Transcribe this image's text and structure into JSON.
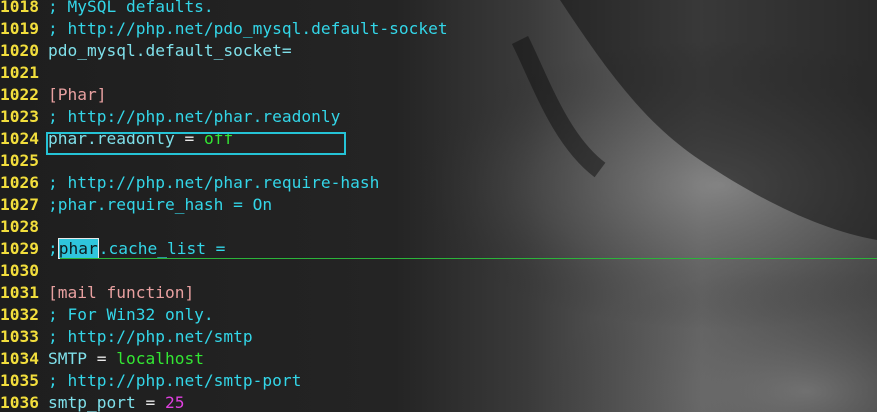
{
  "editor": {
    "lines": [
      {
        "num": "1018",
        "segments": [
          {
            "cls": "comment",
            "text": "; MySQL defaults."
          }
        ]
      },
      {
        "num": "1019",
        "segments": [
          {
            "cls": "comment",
            "text": "; http://php.net/pdo_mysql.default-socket"
          }
        ]
      },
      {
        "num": "1020",
        "segments": [
          {
            "cls": "key",
            "text": "pdo_mysql.default_socket="
          }
        ]
      },
      {
        "num": "1021",
        "segments": []
      },
      {
        "num": "1022",
        "segments": [
          {
            "cls": "section",
            "text": "[Phar]"
          }
        ]
      },
      {
        "num": "1023",
        "segments": [
          {
            "cls": "comment",
            "text": "; http://php.net/phar.readonly"
          }
        ]
      },
      {
        "num": "1024",
        "segments": [
          {
            "cls": "key",
            "text": "phar.readonly"
          },
          {
            "cls": "op",
            "text": " = "
          },
          {
            "cls": "val-green",
            "text": "off"
          }
        ]
      },
      {
        "num": "1025",
        "segments": []
      },
      {
        "num": "1026",
        "segments": [
          {
            "cls": "comment",
            "text": "; http://php.net/phar.require-hash"
          }
        ]
      },
      {
        "num": "1027",
        "segments": [
          {
            "cls": "comment",
            "text": ";phar.require_hash = On"
          }
        ]
      },
      {
        "num": "1028",
        "segments": []
      },
      {
        "num": "1029",
        "segments": [
          {
            "cls": "comment",
            "text": ";"
          },
          {
            "cls": "search-hl",
            "text": "phar"
          },
          {
            "cls": "comment",
            "text": ".cache_list ="
          }
        ]
      },
      {
        "num": "1030",
        "segments": []
      },
      {
        "num": "1031",
        "segments": [
          {
            "cls": "section",
            "text": "[mail function]"
          }
        ]
      },
      {
        "num": "1032",
        "segments": [
          {
            "cls": "comment",
            "text": "; For Win32 only."
          }
        ]
      },
      {
        "num": "1033",
        "segments": [
          {
            "cls": "comment",
            "text": "; http://php.net/smtp"
          }
        ]
      },
      {
        "num": "1034",
        "segments": [
          {
            "cls": "key",
            "text": "SMTP"
          },
          {
            "cls": "op",
            "text": " = "
          },
          {
            "cls": "val-green",
            "text": "localhost"
          }
        ]
      },
      {
        "num": "1035",
        "segments": [
          {
            "cls": "comment",
            "text": "; http://php.net/smtp-port"
          }
        ]
      },
      {
        "num": "1036",
        "segments": [
          {
            "cls": "key",
            "text": "smtp_port"
          },
          {
            "cls": "op",
            "text": " = "
          },
          {
            "cls": "val-magenta",
            "text": "25"
          }
        ]
      }
    ]
  },
  "colors": {
    "line_number": "#f2de3c",
    "comment": "#33d6e8",
    "section": "#e8a0a0",
    "key": "#7fe0ea",
    "value_string": "#33e633",
    "value_number": "#e040e0",
    "highlight_box": "#25c3d6",
    "cursor_line": "#2bb33a"
  }
}
